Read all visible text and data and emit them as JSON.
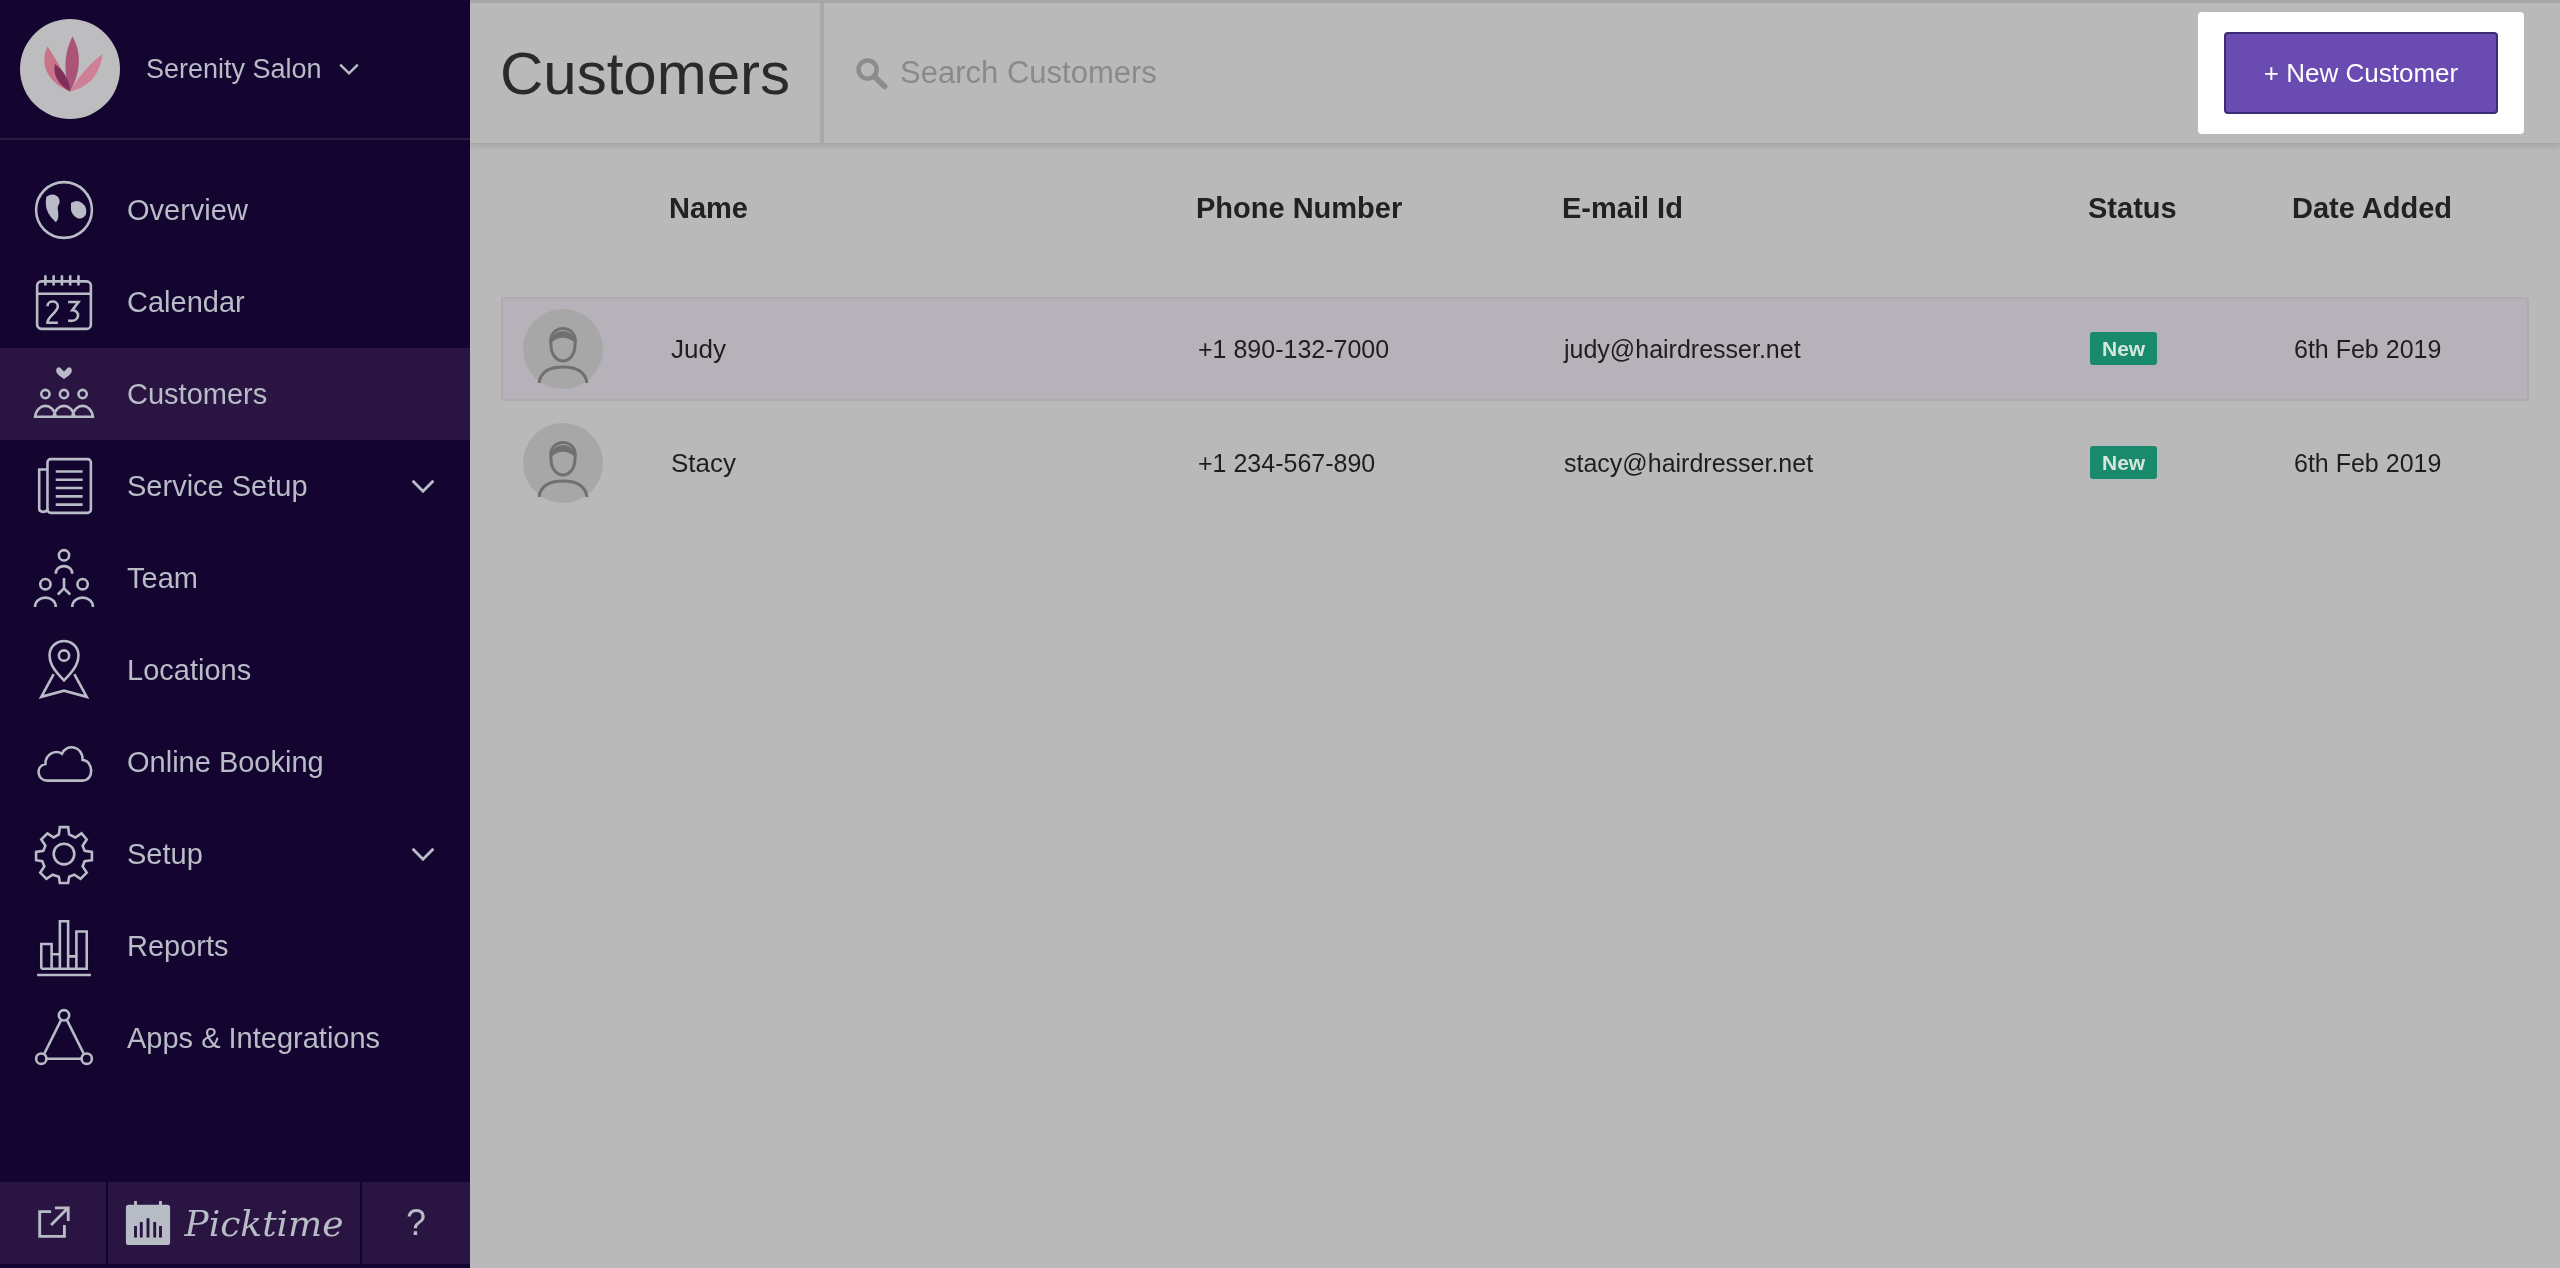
{
  "sidebar": {
    "salon_name": "Serenity Salon",
    "items": [
      {
        "label": "Overview",
        "selected": false,
        "submenu": false
      },
      {
        "label": "Calendar",
        "selected": false,
        "submenu": false
      },
      {
        "label": "Customers",
        "selected": true,
        "submenu": false
      },
      {
        "label": "Service Setup",
        "selected": false,
        "submenu": true
      },
      {
        "label": "Team",
        "selected": false,
        "submenu": false
      },
      {
        "label": "Locations",
        "selected": false,
        "submenu": false
      },
      {
        "label": "Online Booking",
        "selected": false,
        "submenu": false
      },
      {
        "label": "Setup",
        "selected": false,
        "submenu": true
      },
      {
        "label": "Reports",
        "selected": false,
        "submenu": false
      },
      {
        "label": "Apps & Integrations",
        "selected": false,
        "submenu": false
      }
    ],
    "footer": {
      "brand": "Picktime",
      "help": "?"
    }
  },
  "header": {
    "title": "Customers",
    "search": {
      "placeholder": "Search Customers"
    },
    "new_button": "+ New Customer"
  },
  "table": {
    "columns": [
      "Name",
      "Phone Number",
      "E-mail Id",
      "Status",
      "Date Added"
    ],
    "rows": [
      {
        "name": "Judy",
        "phone": "+1 890-132-7000",
        "email": "judy@hairdresser.net",
        "status": "New",
        "date": "6th Feb 2019",
        "selected": true
      },
      {
        "name": "Stacy",
        "phone": "+1 234-567-890",
        "email": "stacy@hairdresser.net",
        "status": "New",
        "date": "6th Feb 2019",
        "selected": false
      }
    ]
  }
}
